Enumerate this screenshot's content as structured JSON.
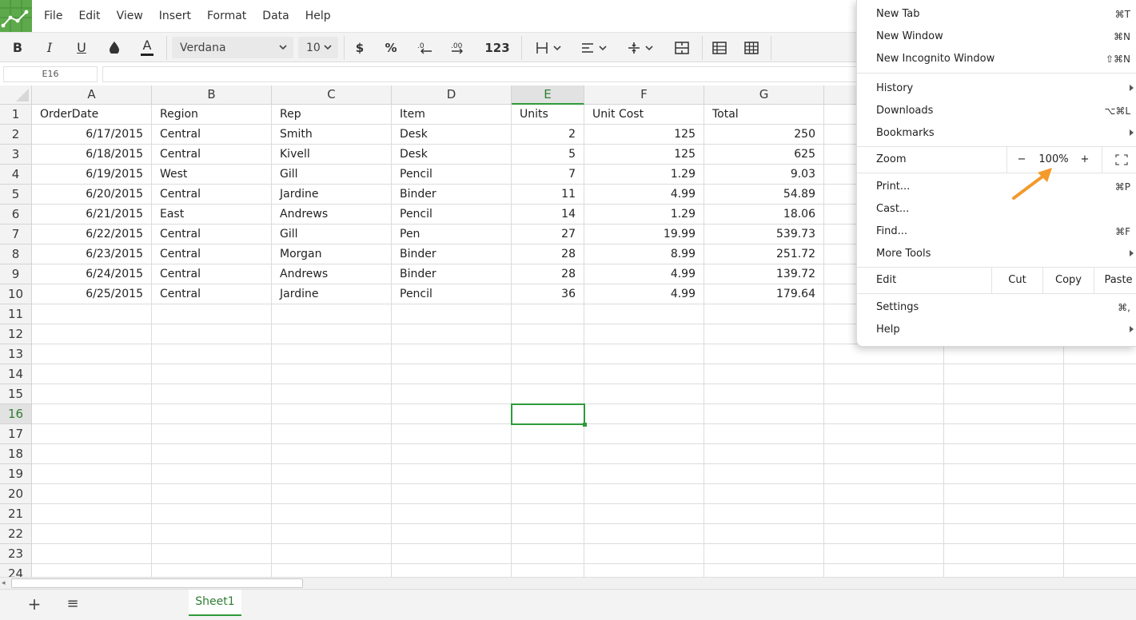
{
  "app": {
    "menus": [
      "File",
      "Edit",
      "View",
      "Insert",
      "Format",
      "Data",
      "Help"
    ]
  },
  "toolbar": {
    "bold": "B",
    "italic": "I",
    "underline": "U",
    "text_color": "A",
    "font_family": "Verdana",
    "font_size": "10",
    "currency": "$",
    "percent": "%",
    "number_format": "123"
  },
  "formula_bar": {
    "cell_ref": "E16",
    "value": ""
  },
  "sheet": {
    "columns": [
      "A",
      "B",
      "C",
      "D",
      "E",
      "F",
      "G"
    ],
    "active_column": "E",
    "active_row": "16",
    "rows": [
      {
        "n": "1",
        "cells": [
          "OrderDate",
          "Region",
          "Rep",
          "Item",
          "Units",
          "Unit Cost",
          "Total"
        ]
      },
      {
        "n": "2",
        "cells": [
          "6/17/2015",
          "Central",
          "Smith",
          "Desk",
          "2",
          "125",
          "250"
        ]
      },
      {
        "n": "3",
        "cells": [
          "6/18/2015",
          "Central",
          "Kivell",
          "Desk",
          "5",
          "125",
          "625"
        ]
      },
      {
        "n": "4",
        "cells": [
          "6/19/2015",
          "West",
          "Gill",
          "Pencil",
          "7",
          "1.29",
          "9.03"
        ]
      },
      {
        "n": "5",
        "cells": [
          "6/20/2015",
          "Central",
          "Jardine",
          "Binder",
          "11",
          "4.99",
          "54.89"
        ]
      },
      {
        "n": "6",
        "cells": [
          "6/21/2015",
          "East",
          "Andrews",
          "Pencil",
          "14",
          "1.29",
          "18.06"
        ]
      },
      {
        "n": "7",
        "cells": [
          "6/22/2015",
          "Central",
          "Gill",
          "Pen",
          "27",
          "19.99",
          "539.73"
        ]
      },
      {
        "n": "8",
        "cells": [
          "6/23/2015",
          "Central",
          "Morgan",
          "Binder",
          "28",
          "8.99",
          "251.72"
        ]
      },
      {
        "n": "9",
        "cells": [
          "6/24/2015",
          "Central",
          "Andrews",
          "Binder",
          "28",
          "4.99",
          "139.72"
        ]
      },
      {
        "n": "10",
        "cells": [
          "6/25/2015",
          "Central",
          "Jardine",
          "Pencil",
          "36",
          "4.99",
          "179.64"
        ]
      },
      {
        "n": "11",
        "cells": [
          "",
          "",
          "",
          "",
          "",
          "",
          ""
        ]
      },
      {
        "n": "12",
        "cells": [
          "",
          "",
          "",
          "",
          "",
          "",
          ""
        ]
      },
      {
        "n": "13",
        "cells": [
          "",
          "",
          "",
          "",
          "",
          "",
          ""
        ]
      },
      {
        "n": "14",
        "cells": [
          "",
          "",
          "",
          "",
          "",
          "",
          ""
        ]
      },
      {
        "n": "15",
        "cells": [
          "",
          "",
          "",
          "",
          "",
          "",
          ""
        ]
      },
      {
        "n": "16",
        "cells": [
          "",
          "",
          "",
          "",
          "",
          "",
          ""
        ]
      },
      {
        "n": "17",
        "cells": [
          "",
          "",
          "",
          "",
          "",
          "",
          ""
        ]
      },
      {
        "n": "18",
        "cells": [
          "",
          "",
          "",
          "",
          "",
          "",
          ""
        ]
      },
      {
        "n": "19",
        "cells": [
          "",
          "",
          "",
          "",
          "",
          "",
          ""
        ]
      },
      {
        "n": "20",
        "cells": [
          "",
          "",
          "",
          "",
          "",
          "",
          ""
        ]
      },
      {
        "n": "21",
        "cells": [
          "",
          "",
          "",
          "",
          "",
          "",
          ""
        ]
      },
      {
        "n": "22",
        "cells": [
          "",
          "",
          "",
          "",
          "",
          "",
          ""
        ]
      },
      {
        "n": "23",
        "cells": [
          "",
          "",
          "",
          "",
          "",
          "",
          ""
        ]
      },
      {
        "n": "24",
        "cells": [
          "",
          "",
          "",
          "",
          "",
          "",
          ""
        ]
      }
    ]
  },
  "sheet_tabs": {
    "add": "+",
    "list": "≡",
    "active_tab": "Sheet1"
  },
  "browser_menu": {
    "new_tab": {
      "label": "New Tab",
      "shortcut": "⌘T"
    },
    "new_window": {
      "label": "New Window",
      "shortcut": "⌘N"
    },
    "new_incognito": {
      "label": "New Incognito Window",
      "shortcut": "⇧⌘N"
    },
    "history": {
      "label": "History"
    },
    "downloads": {
      "label": "Downloads",
      "shortcut": "⌥⌘L"
    },
    "bookmarks": {
      "label": "Bookmarks"
    },
    "zoom": {
      "label": "Zoom",
      "minus": "−",
      "value": "100%",
      "plus": "+"
    },
    "print": {
      "label": "Print...",
      "shortcut": "⌘P"
    },
    "cast": {
      "label": "Cast..."
    },
    "find": {
      "label": "Find...",
      "shortcut": "⌘F"
    },
    "more_tools": {
      "label": "More Tools"
    },
    "edit": {
      "label": "Edit",
      "cut": "Cut",
      "copy": "Copy",
      "paste": "Paste"
    },
    "settings": {
      "label": "Settings",
      "shortcut": "⌘,"
    },
    "help": {
      "label": "Help"
    }
  },
  "colors": {
    "accent_green": "#2e9b3a",
    "logo_green": "#5da94b",
    "annotation_arrow": "#f39a2b"
  }
}
